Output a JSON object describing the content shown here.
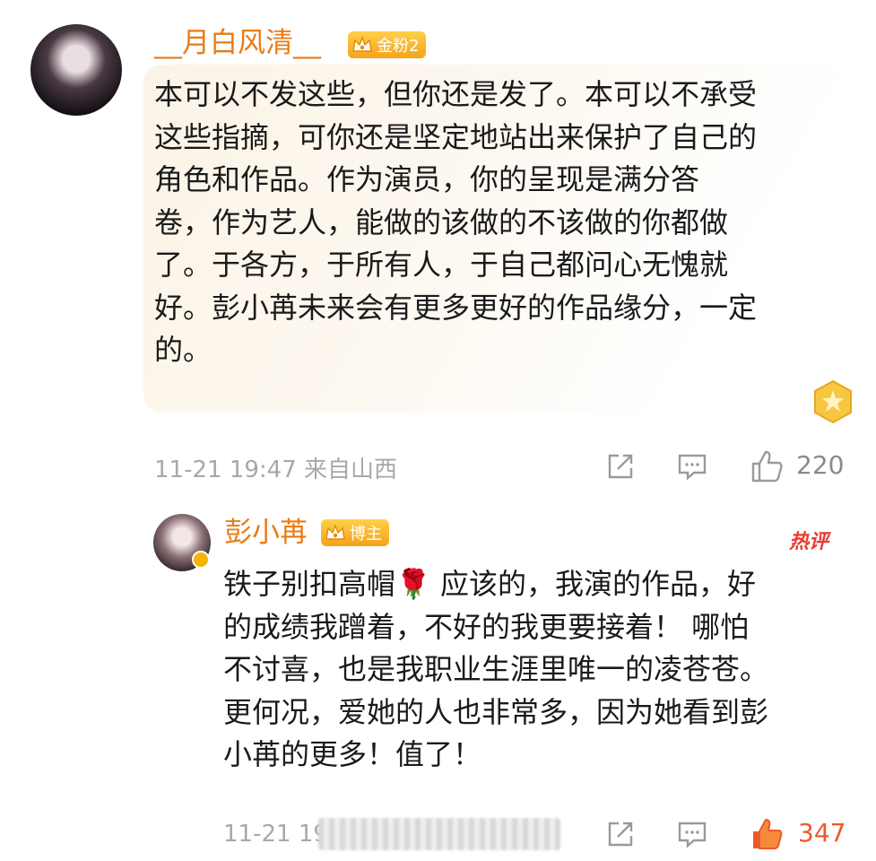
{
  "comment": {
    "username": "__月白风清__",
    "badge": "金粉2",
    "text_lines": [
      "本可以不发这些，但你还是发了。本可以不承受",
      "这些指摘，可你还是坚定地站出来保护了自己的",
      "角色和作品。作为演员，你的呈现是满分答",
      "卷，作为艺人，能做的该做的不该做的你都做",
      "了。于各方，于所有人，于自己都问心无愧就",
      "好。彭小苒未来会有更多更好的作品缘分，一定",
      "的。"
    ],
    "meta": "11-21 19:47  来自山西",
    "like_count": "220"
  },
  "reply": {
    "username": "彭小苒",
    "badge": "博主",
    "hot_label": "热评",
    "text_lines": [
      "铁子别扣高帽🌹 应该的，我演的作品，好",
      "的成绩我蹭着，不好的我更要接着！ 哪怕",
      "不讨喜，也是我职业生涯里唯一的凌苍苍。",
      "更何况，爱她的人也非常多，因为她看到彭",
      "小苒的更多！值了！"
    ],
    "meta": "11-21 19",
    "like_count": "347"
  },
  "colors": {
    "username": "#e87b14",
    "badge_bg": "#f6a21a",
    "hot_label": "#ea3a2f",
    "liked": "#f0582a",
    "meta": "#a8a8a8"
  },
  "icons": [
    "share-icon",
    "comment-icon",
    "like-icon",
    "liked-icon",
    "crown-icon",
    "medal-icon"
  ]
}
